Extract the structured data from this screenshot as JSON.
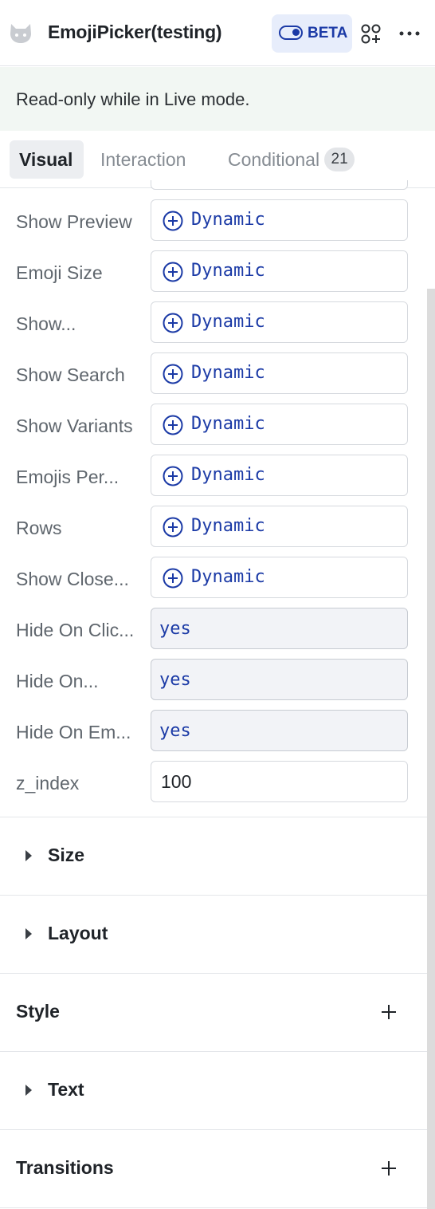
{
  "header": {
    "title": "EmojiPicker(testing)",
    "beta_label": "BETA",
    "component_icon": "cat-icon",
    "apps_icon": "apps-add-icon",
    "more_icon": "more-horizontal-icon"
  },
  "notice": {
    "text": "Read-only while in Live mode."
  },
  "tabs": {
    "visual": "Visual",
    "interaction": "Interaction",
    "conditional": "Conditional",
    "conditional_count": "21",
    "active": "Visual"
  },
  "properties": [
    {
      "label": "Show Preview",
      "kind": "dynamic",
      "value": "Dynamic"
    },
    {
      "label": "Emoji Size",
      "kind": "dynamic",
      "value": "Dynamic"
    },
    {
      "label": "Show...",
      "kind": "dynamic",
      "value": "Dynamic"
    },
    {
      "label": "Show Search",
      "kind": "dynamic",
      "value": "Dynamic"
    },
    {
      "label": "Show Variants",
      "kind": "dynamic",
      "value": "Dynamic"
    },
    {
      "label": "Emojis Per...",
      "kind": "dynamic",
      "value": "Dynamic"
    },
    {
      "label": "Rows",
      "kind": "dynamic",
      "value": "Dynamic"
    },
    {
      "label": "Show Close...",
      "kind": "dynamic",
      "value": "Dynamic"
    },
    {
      "label": "Hide On Clic...",
      "kind": "static",
      "value": "yes"
    },
    {
      "label": "Hide On...",
      "kind": "static",
      "value": "yes"
    },
    {
      "label": "Hide On Em...",
      "kind": "static",
      "value": "yes"
    },
    {
      "label": "z_index",
      "kind": "number",
      "value": "100"
    }
  ],
  "sections": [
    {
      "title": "Size",
      "collapsible": true,
      "addable": false
    },
    {
      "title": "Layout",
      "collapsible": true,
      "addable": false
    },
    {
      "title": "Style",
      "collapsible": false,
      "addable": true
    },
    {
      "title": "Text",
      "collapsible": true,
      "addable": false
    },
    {
      "title": "Transitions",
      "collapsible": false,
      "addable": true
    }
  ],
  "colors": {
    "accent": "#1b3aa6",
    "notice_bg": "#f2f7f3",
    "beta_bg": "#e7edfb",
    "static_field_bg": "#f2f3f7"
  }
}
